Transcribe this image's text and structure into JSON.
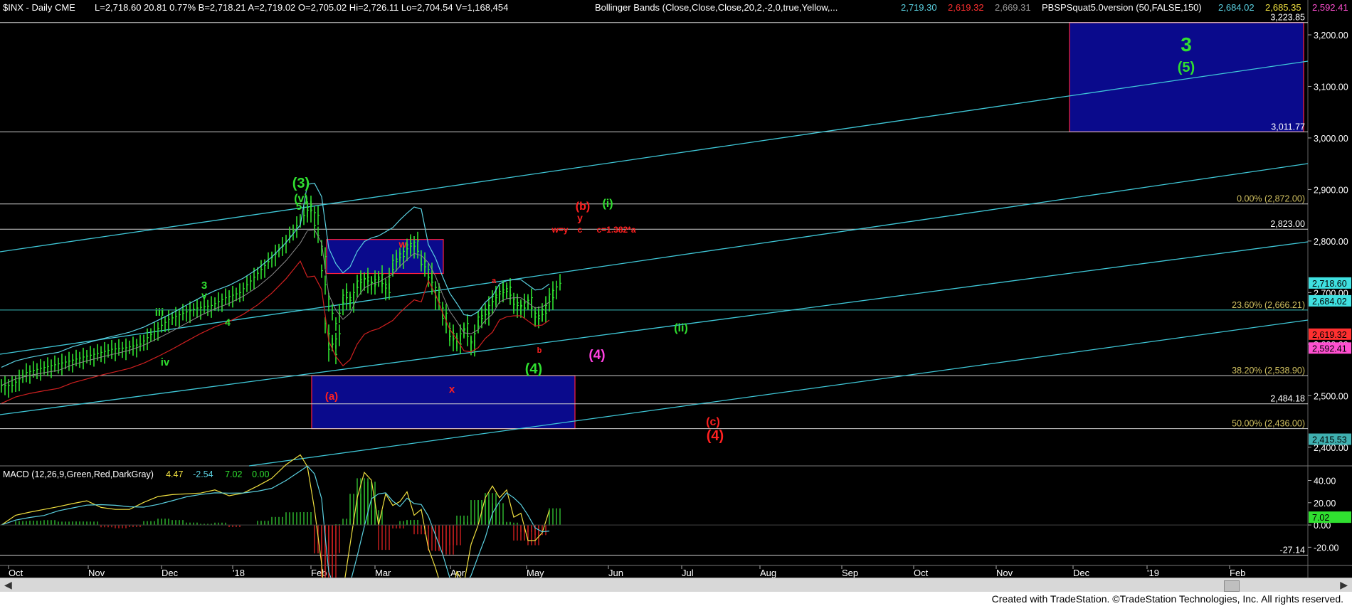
{
  "header": {
    "symbol": "$INX - Daily  CME",
    "ohlc": "L=2,718.60  20.81  0.77%  B=2,718.21  A=2,719.02  O=2,705.02  Hi=2,726.11  Lo=2,704.54  V=1,168,454",
    "bb_label": "Bollinger Bands (Close,Close,Close,20,2,-2,0,true,Yellow,...",
    "bb_values": [
      "2,719.30",
      "2,619.32",
      "2,669.31"
    ],
    "bb_colors": [
      "#5ad0e0",
      "#ff3030",
      "#9a9a9a"
    ],
    "pbs_label": "PBSPSquat5.0version (50,FALSE,150)",
    "pbs_values": [
      "2,684.02",
      "2,685.35",
      "2,592.41",
      "2,415.53"
    ],
    "pbs_colors": [
      "#5ad0e0",
      "#f0e040",
      "#ff4fd0",
      "#5ad0e0"
    ]
  },
  "chart_data": [
    {
      "type": "bar",
      "name": "$INX - Daily",
      "ylim": [
        2390,
        3240
      ],
      "x_ticks": [
        "Oct",
        "Nov",
        "Dec",
        "'18",
        "Feb",
        "Mar",
        "Apr",
        "May",
        "Jun",
        "Jul",
        "Aug",
        "Sep",
        "Oct",
        "Nov",
        "Dec",
        "'19",
        "Feb"
      ],
      "y_ticks": [
        2400,
        2500,
        2600,
        2700,
        2800,
        2900,
        3000,
        3100,
        3200
      ],
      "y_tick_labels": [
        "2,400.00",
        "2,500.00",
        "2,600.00",
        "2,700.00",
        "2,800.00",
        "2,900.00",
        "3,000.00",
        "3,100.00",
        "3,200.00"
      ],
      "price_points": [
        [
          0,
          2520
        ],
        [
          20,
          2545
        ],
        [
          40,
          2553
        ],
        [
          60,
          2560
        ],
        [
          80,
          2567
        ],
        [
          100,
          2575
        ],
        [
          120,
          2582
        ],
        [
          140,
          2590
        ],
        [
          160,
          2593
        ],
        [
          180,
          2600
        ],
        [
          200,
          2625
        ],
        [
          220,
          2648
        ],
        [
          240,
          2660
        ],
        [
          260,
          2670
        ],
        [
          280,
          2675
        ],
        [
          300,
          2690
        ],
        [
          320,
          2700
        ],
        [
          340,
          2730
        ],
        [
          360,
          2760
        ],
        [
          380,
          2790
        ],
        [
          400,
          2830
        ],
        [
          420,
          2870
        ],
        [
          430,
          2850
        ],
        [
          440,
          2770
        ],
        [
          450,
          2660
        ],
        [
          455,
          2580
        ],
        [
          460,
          2620
        ],
        [
          470,
          2700
        ],
        [
          480,
          2680
        ],
        [
          490,
          2720
        ],
        [
          500,
          2730
        ],
        [
          510,
          2715
        ],
        [
          520,
          2735
        ],
        [
          530,
          2700
        ],
        [
          540,
          2760
        ],
        [
          550,
          2770
        ],
        [
          560,
          2790
        ],
        [
          570,
          2800
        ],
        [
          580,
          2760
        ],
        [
          590,
          2740
        ],
        [
          600,
          2700
        ],
        [
          610,
          2660
        ],
        [
          620,
          2620
        ],
        [
          630,
          2600
        ],
        [
          640,
          2640
        ],
        [
          650,
          2590
        ],
        [
          660,
          2650
        ],
        [
          670,
          2660
        ],
        [
          680,
          2690
        ],
        [
          690,
          2700
        ],
        [
          700,
          2710
        ],
        [
          710,
          2680
        ],
        [
          720,
          2670
        ],
        [
          730,
          2690
        ],
        [
          740,
          2650
        ],
        [
          750,
          2660
        ],
        [
          760,
          2690
        ],
        [
          770,
          2718
        ]
      ],
      "horizontal_levels": [
        {
          "value": 3223.85,
          "label": "3,223.85"
        },
        {
          "value": 3011.77,
          "label": "3,011.77"
        },
        {
          "value": 2872.0,
          "label": "0.00% (2,872.00)"
        },
        {
          "value": 2823.0,
          "label": "2,823.00"
        },
        {
          "value": 2666.21,
          "label": "23.60% (2,666.21)"
        },
        {
          "value": 2538.9,
          "label": "38.20% (2,538.90)"
        },
        {
          "value": 2484.18,
          "label": "2,484.18"
        },
        {
          "value": 2436.0,
          "label": "50.00% (2,436.00)"
        }
      ],
      "axis_badges": [
        {
          "value": 2718.6,
          "label": "2,718.60",
          "color": "#3fe0e0"
        },
        {
          "value": 2684.02,
          "label": "2,684.02",
          "color": "#3fe0e0"
        },
        {
          "value": 2619.32,
          "label": "2,619.32",
          "color": "#ff3030"
        },
        {
          "value": 2592.41,
          "label": "2,592.41",
          "color": "#ff4fd0"
        },
        {
          "value": 2415.53,
          "label": "2,415.53",
          "color": "#3fb0b0"
        }
      ],
      "target_boxes": [
        {
          "from": 3223.85,
          "to": 3011.77,
          "labels": [
            "3",
            "(5)"
          ]
        },
        {
          "from": 2803,
          "to": 2737
        },
        {
          "from": 2538.9,
          "to": 2436
        }
      ],
      "wave_labels": [
        {
          "text": "(3)",
          "color": "#30e030"
        },
        {
          "text": "(v)",
          "color": "#30e030"
        },
        {
          "text": "5",
          "color": "#30e030"
        },
        {
          "text": "iii",
          "color": "#30e030"
        },
        {
          "text": "iv",
          "color": "#30e030"
        },
        {
          "text": "3",
          "color": "#30e030"
        },
        {
          "text": "v",
          "color": "#30e030"
        },
        {
          "text": "4",
          "color": "#30e030"
        },
        {
          "text": "(a)",
          "color": "#ff2020"
        },
        {
          "text": "w",
          "color": "#ff2020"
        },
        {
          "text": "x",
          "color": "#ff2020"
        },
        {
          "text": "a",
          "color": "#ff2020"
        },
        {
          "text": "b",
          "color": "#ff2020"
        },
        {
          "text": "(4)",
          "color": "#30e030"
        },
        {
          "text": "(4)",
          "color": "#ff40e0"
        },
        {
          "text": "(b)",
          "color": "#ff2020"
        },
        {
          "text": "y",
          "color": "#ff2020"
        },
        {
          "text": "c",
          "color": "#ff2020"
        },
        {
          "text": "w=y",
          "color": "#ff2020"
        },
        {
          "text": "c=1.382*a",
          "color": "#ff2020"
        },
        {
          "text": "(i)",
          "color": "#30e030"
        },
        {
          "text": "(ii)",
          "color": "#30e030"
        },
        {
          "text": "(c)",
          "color": "#ff2020"
        },
        {
          "text": "(4)",
          "color": "#ff2020"
        }
      ]
    },
    {
      "type": "line",
      "name": "MACD",
      "legend": "MACD (12,26,9,Green,Red,DarkGray)",
      "values": [
        "4.47",
        "-2.54",
        "7.02",
        "0.00"
      ],
      "value_colors": [
        "#f0e040",
        "#5ad0e0",
        "#30e030",
        "#30e030"
      ],
      "y_ticks": [
        40,
        20,
        0,
        -20
      ],
      "y_tick_labels": [
        "40.00",
        "20.00",
        "0.00",
        "-20.00"
      ],
      "ylim": [
        -30,
        48
      ],
      "level": {
        "value": -27.14,
        "label": "-27.14"
      },
      "badge": {
        "value": 7.02,
        "label": "7.02",
        "color": "#30e030"
      }
    }
  ],
  "footer": {
    "credit": "Created with TradeStation. ©TradeStation Technologies, Inc. All rights reserved."
  }
}
